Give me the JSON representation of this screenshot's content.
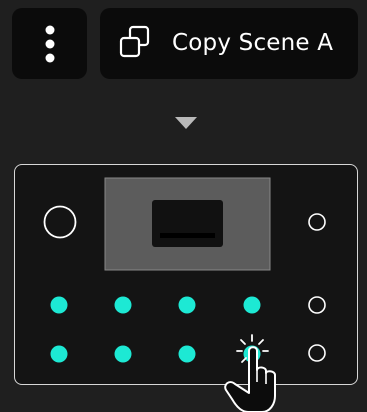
{
  "toolbar": {
    "more_icon": "vertical-dots-icon",
    "copy_button": {
      "label": "Copy Scene A",
      "icon": "copy-icon"
    }
  },
  "indicator": {
    "icon": "down-triangle-icon"
  },
  "device": {
    "screen_icon": "display-screen",
    "pads": {
      "rows": 2,
      "cols": 4,
      "active_color": "#1de9d4",
      "states": [
        [
          true,
          true,
          true,
          true
        ],
        [
          true,
          true,
          true,
          true
        ]
      ]
    },
    "side_buttons": 3,
    "tap_icon": "tap-hand-icon"
  }
}
